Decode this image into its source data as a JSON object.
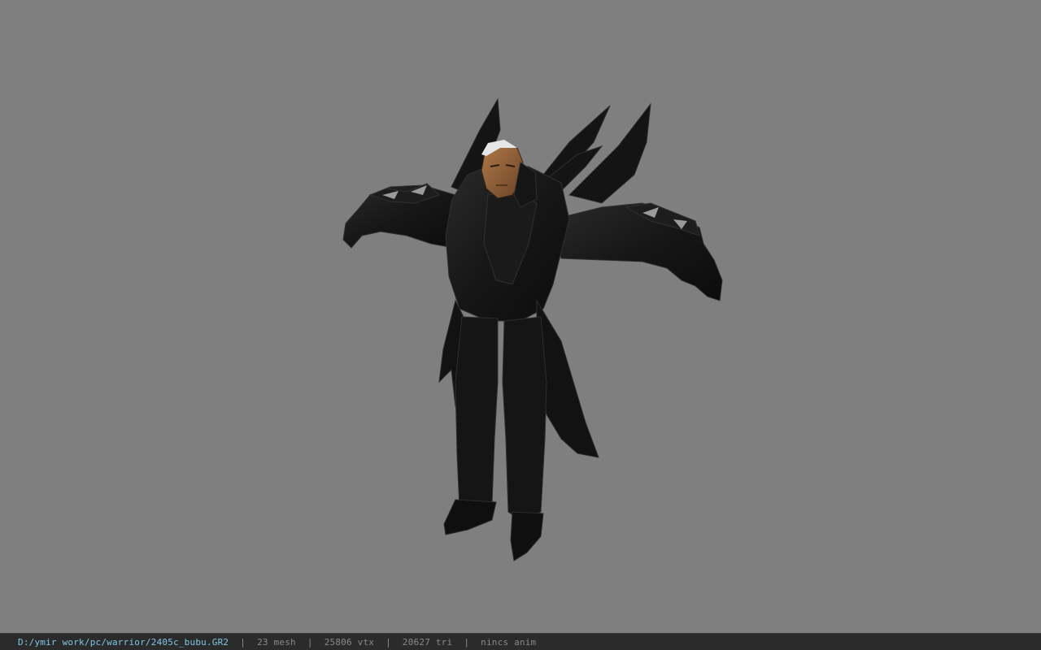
{
  "viewer": {
    "background_color": "#7f7f7f",
    "model_name": "2405c_bubu"
  },
  "statusbar": {
    "path": "D:/ymir work/pc/warrior/2405c_bubu.GR2",
    "separator": "|",
    "mesh": "23 mesh",
    "vtx": "25806 vtx",
    "tri": "20627 tri",
    "anim": "nincs anim",
    "path_color": "#7fc7e8",
    "stat_color": "#8a8a8a"
  }
}
